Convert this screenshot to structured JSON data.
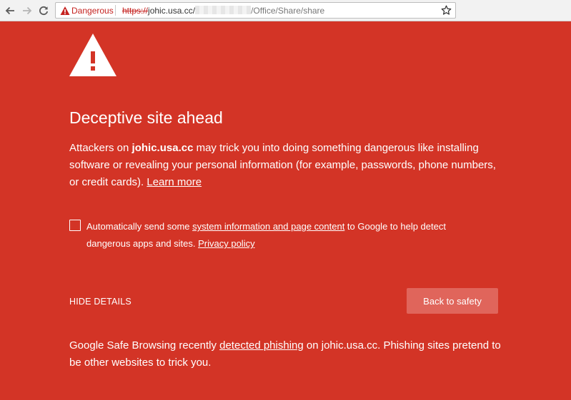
{
  "browser": {
    "danger_label": "Dangerous",
    "url_scheme": "https://",
    "url_host": "johic.usa.cc/",
    "url_path": "/Office/Share/share"
  },
  "page": {
    "heading": "Deceptive site ahead",
    "body_prefix": "Attackers on ",
    "body_host": "johic.usa.cc",
    "body_suffix": " may trick you into doing something dangerous like installing software or revealing your personal information (for example, passwords, phone numbers, or credit cards). ",
    "learn_more": "Learn more",
    "optin_prefix": "Automatically send some ",
    "optin_link": "system information and page content",
    "optin_middle": " to Google to help detect dangerous apps and sites. ",
    "privacy_link": "Privacy policy",
    "hide_details": "HIDE DETAILS",
    "back_button": "Back to safety",
    "details_prefix": "Google Safe Browsing recently ",
    "details_link": "detected phishing",
    "details_suffix": " on johic.usa.cc. Phishing sites pretend to be other websites to trick you."
  },
  "colors": {
    "background": "#d33426",
    "button": "#e0655b",
    "danger_text": "#c5221f"
  },
  "icons": [
    "back-arrow-icon",
    "forward-arrow-icon",
    "reload-icon",
    "warning-triangle-icon",
    "bookmark-star-icon"
  ]
}
